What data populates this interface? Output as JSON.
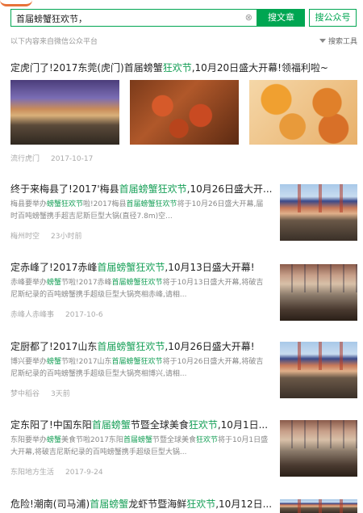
{
  "search": {
    "query": "首届螃蟹狂欢节，",
    "clear_icon": "⊗",
    "article_button": "搜文章",
    "account_button": "搜公众号"
  },
  "subbar": {
    "notice": "以下内容来自微信公众平台",
    "tools_label": "搜索工具"
  },
  "results": [
    {
      "title": "定虎门了!2017东莞(虎门)首届螃蟹狂欢节,10月20日盛大开幕!领福利啦~",
      "title_parts": [
        "定虎门了!2017东莞(虎门)首届螃蟹",
        "狂欢节",
        ",10月20日盛大开幕!领福利啦~"
      ],
      "source": "流行虎门",
      "date": "2017-10-17",
      "images": [
        "night-festival-photo",
        "crabs-photo",
        "cooked-crab-dishes-photo"
      ]
    },
    {
      "title_parts": [
        "终于来梅县了!2017'梅县",
        "首届螃蟹狂欢节",
        ",10月26日盛大开..."
      ],
      "summary_parts": [
        "梅县要举办",
        "螃蟹狂欢节",
        "啦!2017梅县",
        "首届螃蟹狂欢节",
        "将于10月26日盛大开幕,届时百吨螃蟹携手超吉尼斯巨型大锅(直径7.8m)空..."
      ],
      "source": "梅州时空",
      "date": "23小时前"
    },
    {
      "title_parts": [
        "定赤峰了!2017赤峰",
        "首届螃蟹狂欢节",
        ",10月13日盛大开幕!"
      ],
      "summary_parts": [
        "赤峰要举办",
        "螃蟹",
        "节啦!2017赤峰",
        "首届螃蟹狂欢节",
        "将于10月13日盛大开幕,将破吉尼斯纪录的百吨螃蟹携手超级巨型大锅亮相赤峰,请相..."
      ],
      "source": "赤峰人赤峰事",
      "date": "2017-10-6"
    },
    {
      "title_parts": [
        "定厨都了!2017山东",
        "首届螃蟹狂欢节",
        ",10月26日盛大开幕!"
      ],
      "summary_parts": [
        "博兴要举办",
        "螃蟹",
        "节啦!2017山东",
        "首届螃蟹狂欢节",
        "将于10月26日盛大开幕,将破吉尼斯纪录的百吨螃蟹携手超级巨型大锅亮相博兴,请相..."
      ],
      "source": "梦中稻谷",
      "date": "3天前"
    },
    {
      "title_parts": [
        "定东阳了!中国东阳",
        "首届螃蟹",
        "节暨全球美食",
        "狂欢节",
        ",10月1日..."
      ],
      "summary_parts": [
        "东阳要举办",
        "螃蟹",
        "美食节啦2017东阳",
        "首届螃蟹",
        "节暨全球美食",
        "狂欢节",
        "将于10月1日盛大开幕,将破吉尼斯纪录的百吨螃蟹携手超级巨型大锅..."
      ],
      "source": "东阳地方生活",
      "date": "2017-9-24"
    },
    {
      "title_parts": [
        "危险!潮南(司马浦)",
        "首届螃蟹",
        "龙虾节暨海鲜",
        "狂欢节",
        ",10月12日..."
      ]
    }
  ]
}
